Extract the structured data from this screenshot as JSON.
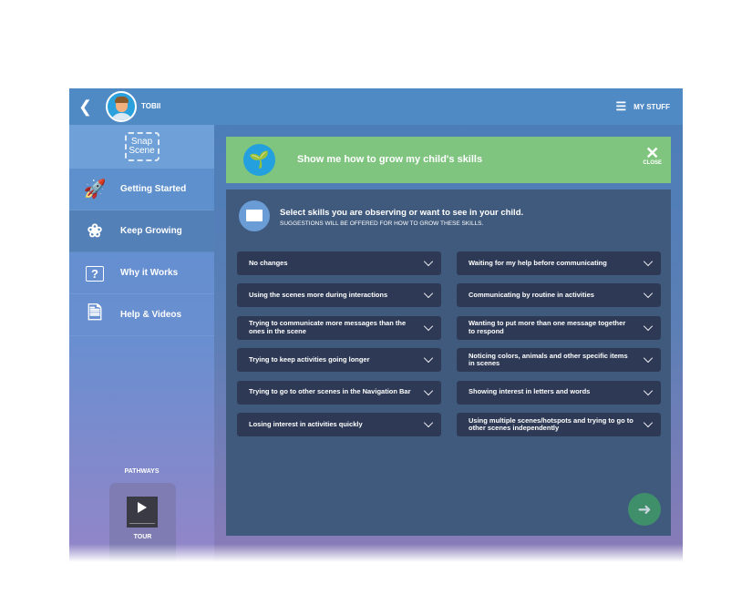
{
  "header": {
    "user_name": "TOBII",
    "my_stuff_label": "MY STUFF"
  },
  "sidebar": {
    "logo": "Snap Scene",
    "items": [
      {
        "label": "Getting Started",
        "icon": "rocket-icon"
      },
      {
        "label": "Keep Growing",
        "icon": "plant-icon",
        "selected": true
      },
      {
        "label": "Why it Works",
        "icon": "question-icon"
      },
      {
        "label": "Help & Videos",
        "icon": "document-icon"
      }
    ],
    "pathways_label": "PATHWAYS",
    "tour_label": "TOUR"
  },
  "banner": {
    "title": "Show me how to grow my child's skills",
    "close_label": "CLOSE",
    "color": "#7fc57f"
  },
  "panel": {
    "title": "Select skills you are observing or want to see in your child.",
    "subtitle": "SUGGESTIONS WILL BE OFFERED FOR HOW TO GROW THESE SKILLS.",
    "left": [
      "No changes",
      "Using the scenes more during interactions",
      "Trying to communicate more messages than the ones in the scene",
      "Trying to keep activities going longer",
      "Trying to go to other scenes in the Navigation Bar",
      "Losing interest in activities quickly"
    ],
    "right": [
      "Waiting for my help before communicating",
      "Communicating by routine in activities",
      "Wanting to put more than one message together to respond",
      "Noticing colors, animals and other specific items in scenes",
      "Showing interest in letters and words",
      "Using multiple scenes/hotspots and trying to go to other scenes independently"
    ]
  }
}
